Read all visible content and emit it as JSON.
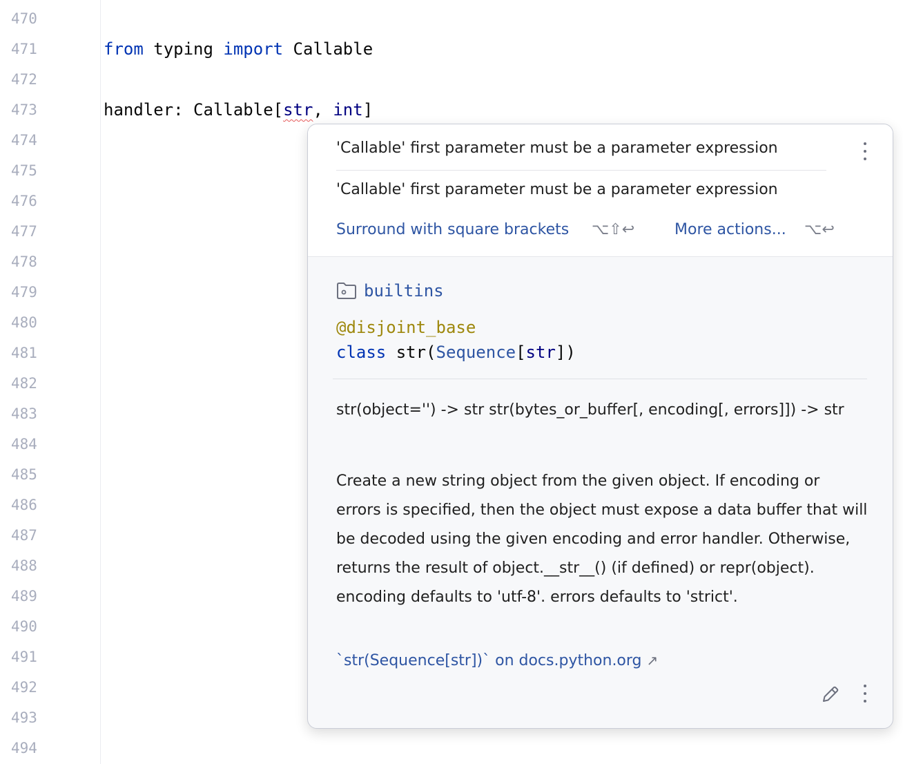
{
  "editor": {
    "line_numbers": [
      "470",
      "471",
      "472",
      "473",
      "474",
      "475",
      "476",
      "477",
      "478",
      "479",
      "480",
      "481",
      "482",
      "483",
      "484",
      "485",
      "486",
      "487",
      "488",
      "489",
      "490",
      "491",
      "492",
      "493",
      "494"
    ],
    "line471": {
      "kw_from": "from",
      "module": " typing ",
      "kw_import": "import",
      "name": " Callable"
    },
    "line473": {
      "prefix": "handler: Callable[",
      "arg1": "str",
      "sep": ", ",
      "arg2": "int",
      "suffix": "]"
    }
  },
  "popup": {
    "problem_messages": [
      "'Callable' first parameter must be a parameter expression",
      "'Callable' first parameter must be a parameter expression"
    ],
    "fix_action": {
      "label": "Surround with square brackets",
      "shortcut": "⌥⇧↩"
    },
    "more_actions": {
      "label": "More actions...",
      "shortcut": "⌥↩"
    },
    "doc": {
      "module": "builtins",
      "decorator": "@disjoint_base",
      "signature": {
        "kw": "class",
        "name": " str(",
        "base": "Sequence",
        "open": "[",
        "arg": "str",
        "close": "])"
      },
      "summary": "str(object='') -> str str(bytes_or_buffer[, encoding[, errors]]) -> str",
      "description": "Create a new string object from the given object. If encoding or errors is specified, then the object must expose a data buffer that will be decoded using the given encoding and error handler. Otherwise, returns the result of object.__str__() (if defined) or repr(object). encoding defaults to 'utf-8'. errors defaults to 'strict'.",
      "external_link": "`str(Sequence[str])` on docs.python.org",
      "external_arrow": "↗"
    },
    "icons": [
      "more-vertical-icon",
      "folder-module-icon",
      "edit-pencil-icon",
      "external-link-arrow-icon"
    ]
  }
}
